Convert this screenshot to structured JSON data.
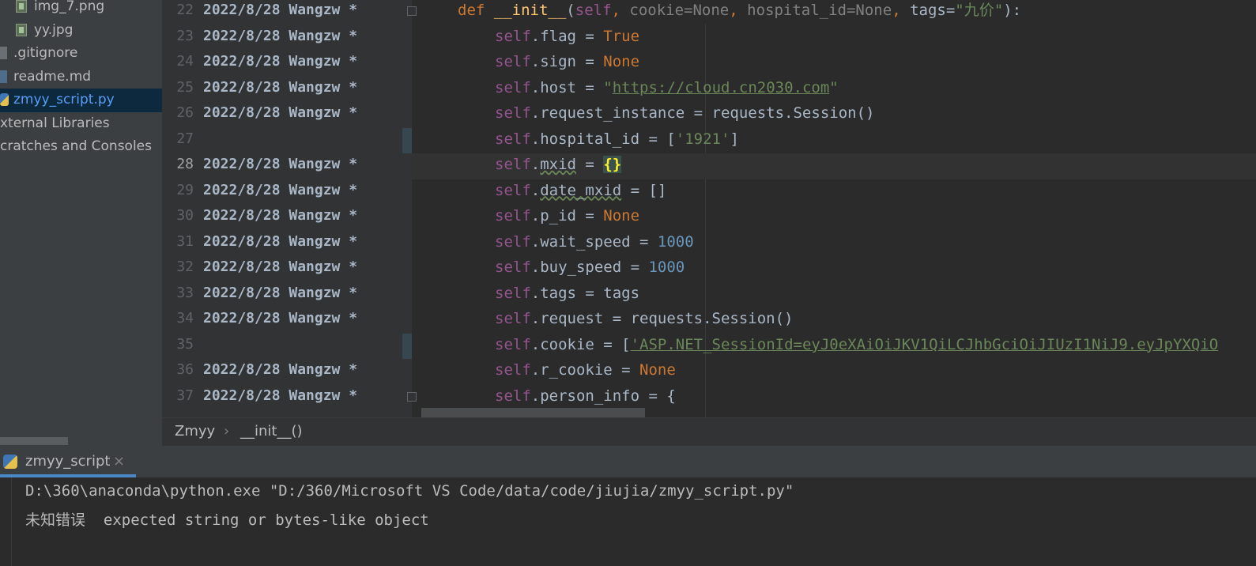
{
  "project_tree": {
    "items": [
      {
        "label": "img_7.png",
        "icon": "image-file-icon",
        "selected": false
      },
      {
        "label": "yy.jpg",
        "icon": "image-file-icon",
        "selected": false
      },
      {
        "label": ".gitignore",
        "icon": "ignore-file-icon",
        "selected": false
      },
      {
        "label": "readme.md",
        "icon": "markdown-file-icon",
        "selected": false
      },
      {
        "label": "zmyy_script.py",
        "icon": "python-file-icon",
        "selected": true
      },
      {
        "label": "xternal Libraries",
        "icon": "",
        "selected": false
      },
      {
        "label": "cratches and Consoles",
        "icon": "",
        "selected": false
      }
    ]
  },
  "editor": {
    "annotations": [
      {
        "line": "22",
        "blame": "2022/8/28 Wangzw *"
      },
      {
        "line": "23",
        "blame": "2022/8/28 Wangzw *"
      },
      {
        "line": "24",
        "blame": "2022/8/28 Wangzw *"
      },
      {
        "line": "25",
        "blame": "2022/8/28 Wangzw *"
      },
      {
        "line": "26",
        "blame": "2022/8/28 Wangzw *"
      },
      {
        "line": "27",
        "blame": ""
      },
      {
        "line": "28",
        "blame": "2022/8/28 Wangzw *"
      },
      {
        "line": "29",
        "blame": "2022/8/28 Wangzw *"
      },
      {
        "line": "30",
        "blame": "2022/8/28 Wangzw *"
      },
      {
        "line": "31",
        "blame": "2022/8/28 Wangzw *"
      },
      {
        "line": "32",
        "blame": "2022/8/28 Wangzw *"
      },
      {
        "line": "33",
        "blame": "2022/8/28 Wangzw *"
      },
      {
        "line": "34",
        "blame": "2022/8/28 Wangzw *"
      },
      {
        "line": "35",
        "blame": ""
      },
      {
        "line": "36",
        "blame": "2022/8/28 Wangzw *"
      },
      {
        "line": "37",
        "blame": "2022/8/28 Wangzw *"
      }
    ],
    "code": {
      "l22": {
        "def": "def",
        "name": "__init__",
        "open": "(",
        "self": "self",
        "c1": ", ",
        "p1": "cookie",
        "e1": "=None",
        "c2": ", ",
        "p2": "hospital_id",
        "e2": "=None",
        "c3": ", ",
        "p3": "tags",
        "e3": "=",
        "tag_val": "\"九价\"",
        "close": "):"
      },
      "l23": {
        "self": "self",
        "rest": ".flag = ",
        "val": "True"
      },
      "l24": {
        "self": "self",
        "rest": ".sign = ",
        "val": "None"
      },
      "l25": {
        "self": "self",
        "rest": ".host = ",
        "q1": "\"",
        "url": "https://cloud.cn2030.com",
        "q2": "\""
      },
      "l26": {
        "self": "self",
        "rest": ".request_instance = requests.Session()"
      },
      "l27": {
        "self": "self",
        "rest": ".hospital_id = [",
        "val": "'1921'",
        "end": "]"
      },
      "l28": {
        "self": "self",
        "dot": ".",
        "attr": "mxid",
        "eq": " = ",
        "val": "{}"
      },
      "l29": {
        "self": "self",
        "dot": ".",
        "attr": "date_mxid",
        "rest": " = []"
      },
      "l30": {
        "self": "self",
        "rest": ".p_id = ",
        "val": "None"
      },
      "l31": {
        "self": "self",
        "rest": ".wait_speed = ",
        "val": "1000"
      },
      "l32": {
        "self": "self",
        "rest": ".buy_speed = ",
        "val": "1000"
      },
      "l33": {
        "self": "self",
        "rest": ".tags = tags"
      },
      "l34": {
        "self": "self",
        "rest": ".request = requests.Session()"
      },
      "l35": {
        "self": "self",
        "rest": ".cookie = [",
        "val": "'ASP.NET_SessionId=eyJ0eXAiOiJKV1QiLCJhbGciOiJIUzI1NiJ9.eyJpYXQiO"
      },
      "l36": {
        "self": "self",
        "rest": ".r_cookie = ",
        "val": "None"
      },
      "l37": {
        "self": "self",
        "rest": ".person_info = {"
      }
    }
  },
  "breadcrumb": {
    "class_name": "Zmyy",
    "separator": "›",
    "method": "__init__()"
  },
  "run_panel": {
    "tab_label": "zmyy_script",
    "close_label": "×",
    "console": {
      "command": "D:\\360\\anaconda\\python.exe \"D:/360/Microsoft VS Code/data/code/jiujia/zmyy_script.py\"",
      "error_label": "未知错误",
      "error_message": "expected string or bytes-like object"
    }
  },
  "colors": {
    "accent": "#4a88c7",
    "selection": "#0d293e",
    "keyword": "#cc7832",
    "string": "#6a8759",
    "number": "#6897bb",
    "self": "#94558d"
  }
}
